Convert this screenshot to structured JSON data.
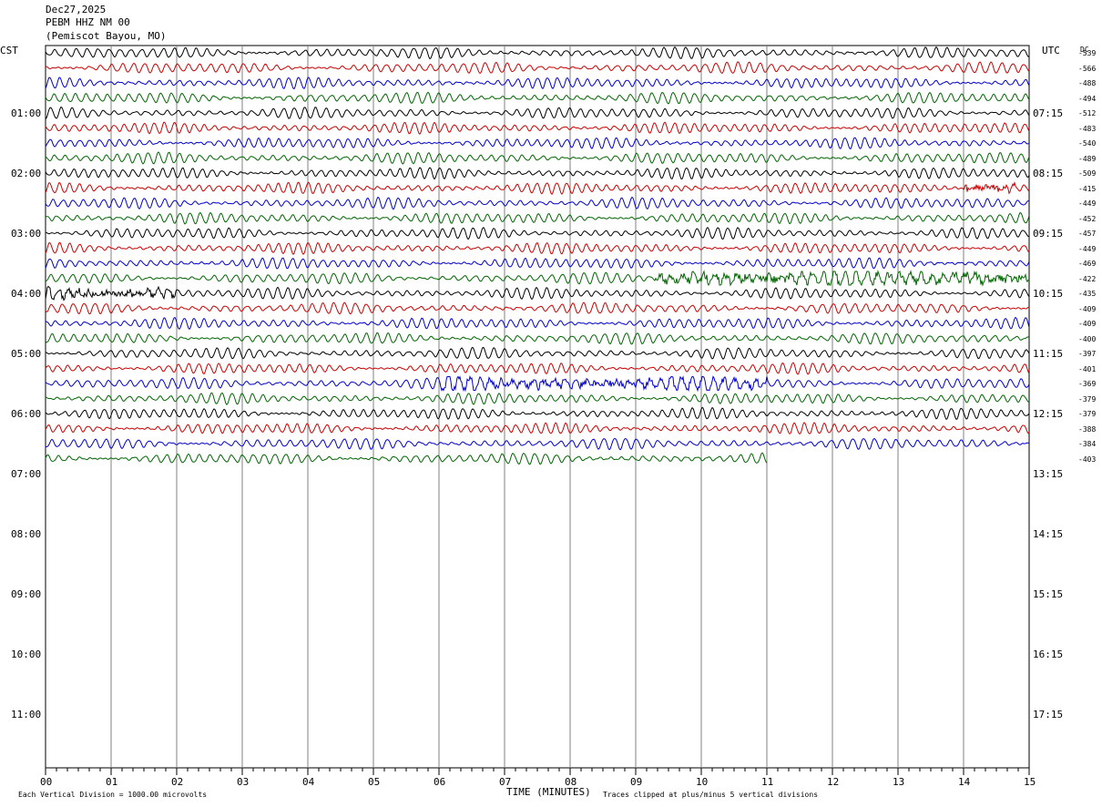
{
  "header": {
    "date": "Dec27,2025",
    "station": "PEBM HHZ NM 00",
    "location": "(Pemiscot Bayou, MO)"
  },
  "left_tz": "CST",
  "right_tz": "UTC",
  "dc_label": "DC",
  "left_hours": [
    "01:00",
    "02:00",
    "03:00",
    "04:00",
    "05:00",
    "06:00",
    "07:00",
    "08:00",
    "09:00",
    "10:00",
    "11:00"
  ],
  "right_hours": [
    "07:15",
    "08:15",
    "09:15",
    "10:15",
    "11:15",
    "12:15",
    "13:15",
    "14:15",
    "15:15",
    "16:15",
    "17:15"
  ],
  "x_ticks": [
    "00",
    "01",
    "02",
    "03",
    "04",
    "05",
    "06",
    "07",
    "08",
    "09",
    "10",
    "11",
    "12",
    "13",
    "14",
    "15"
  ],
  "x_axis_label": "TIME (MINUTES)",
  "footer_left": "Each Vertical Division = 1000.00 microvolts",
  "footer_right": "Traces clipped at plus/minus 5 vertical divisions",
  "dc_values": [
    "-539",
    "-566",
    "-488",
    "-494",
    "-512",
    "-483",
    "-540",
    "-489",
    "-509",
    "-415",
    "-449",
    "-452",
    "-457",
    "-449",
    "-469",
    "-422",
    "-435",
    "-409",
    "-409",
    "-400",
    "-397",
    "-401",
    "-369",
    "-379",
    "-379",
    "-388",
    "-384",
    "-403"
  ],
  "trace_colors": [
    "#000000",
    "#cc0000",
    "#0000cc",
    "#006600"
  ],
  "chart_data": {
    "type": "line",
    "title": "PEBM HHZ NM 00",
    "xlabel": "TIME (MINUTES)",
    "xlim": [
      0,
      15
    ],
    "traces_per_hour": 4,
    "minutes_per_trace": 15,
    "trace_count": 28,
    "last_trace_end_minute": 11,
    "bursts": [
      {
        "trace": 15,
        "start_min": 9.3,
        "end_min": 15,
        "amp": 1.7
      },
      {
        "trace": 16,
        "start_min": 0,
        "end_min": 2,
        "amp": 1.3
      },
      {
        "trace": 22,
        "start_min": 6,
        "end_min": 11,
        "amp": 1.4
      },
      {
        "trace": 9,
        "start_min": 14,
        "end_min": 14.8,
        "amp": 1.5
      }
    ]
  }
}
